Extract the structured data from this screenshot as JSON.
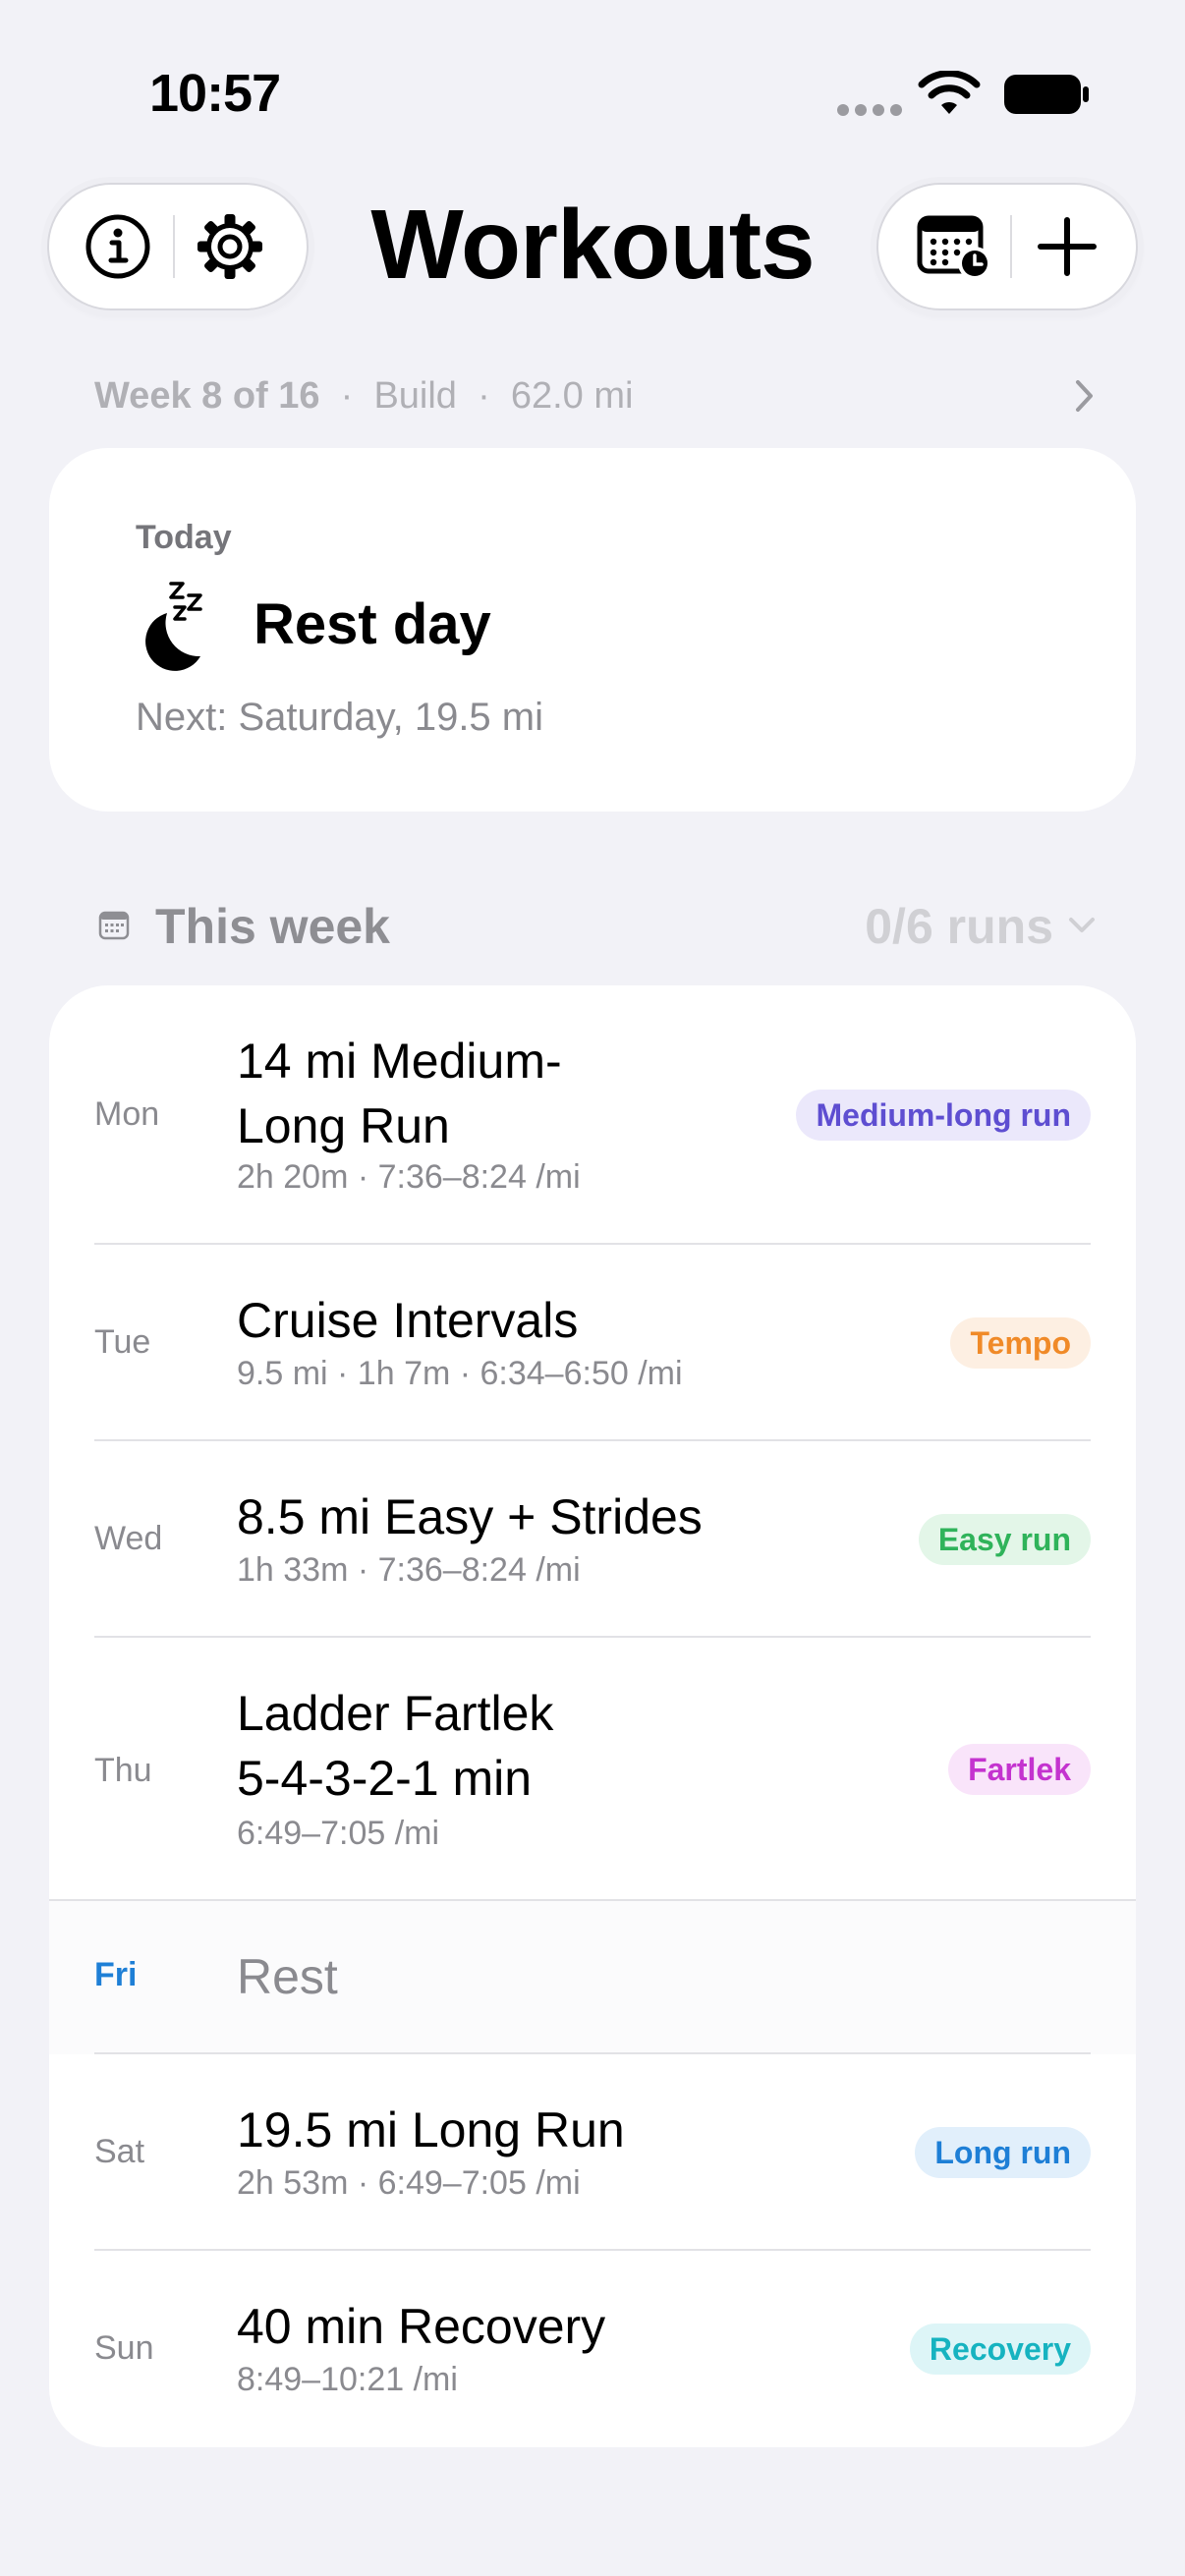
{
  "status_bar": {
    "time": "10:57"
  },
  "header": {
    "title": "Workouts"
  },
  "week_summary": {
    "week": "Week 8 of 16",
    "phase": "Build",
    "distance": "62.0 mi",
    "sep": "·"
  },
  "today": {
    "label": "Today",
    "title": "Rest day",
    "next": "Next: Saturday, 19.5 mi"
  },
  "this_week": {
    "title": "This week",
    "runs": "0/6 runs"
  },
  "days": [
    {
      "day": "Mon",
      "title": "14 mi Medium-\nLong Run",
      "meta": "2h 20m · 7:36–8:24 /mi",
      "badge": "Medium-long run",
      "badge_color": "#5e4ed1",
      "badge_bg": "#ebe8fb"
    },
    {
      "day": "Tue",
      "title": "Cruise Intervals",
      "meta": "9.5 mi · 1h 7m · 6:34–6:50 /mi",
      "badge": "Tempo",
      "badge_color": "#f08a28",
      "badge_bg": "#fdefe2"
    },
    {
      "day": "Wed",
      "title": "8.5 mi Easy + Strides",
      "meta": "1h 33m · 7:36–8:24 /mi",
      "badge": "Easy run",
      "badge_color": "#2fb35a",
      "badge_bg": "#e3f6e8"
    },
    {
      "day": "Thu",
      "title": "Ladder Fartlek\n5-4-3-2-1 min",
      "meta": "6:49–7:05 /mi",
      "badge": "Fartlek",
      "badge_color": "#c433cf",
      "badge_bg": "#f9e4fa"
    },
    {
      "day": "Fri",
      "title": "Rest",
      "meta": "",
      "badge": "",
      "badge_color": "",
      "badge_bg": ""
    },
    {
      "day": "Sat",
      "title": "19.5 mi Long Run",
      "meta": "2h 53m · 6:49–7:05 /mi",
      "badge": "Long run",
      "badge_color": "#1e7fd6",
      "badge_bg": "#e1effb"
    },
    {
      "day": "Sun",
      "title": "40 min Recovery",
      "meta": "8:49–10:21 /mi",
      "badge": "Recovery",
      "badge_color": "#16b3c0",
      "badge_bg": "#ddf5f7"
    }
  ],
  "colors": {
    "accent": "#1e7fd6",
    "background": "#f2f2f7"
  }
}
